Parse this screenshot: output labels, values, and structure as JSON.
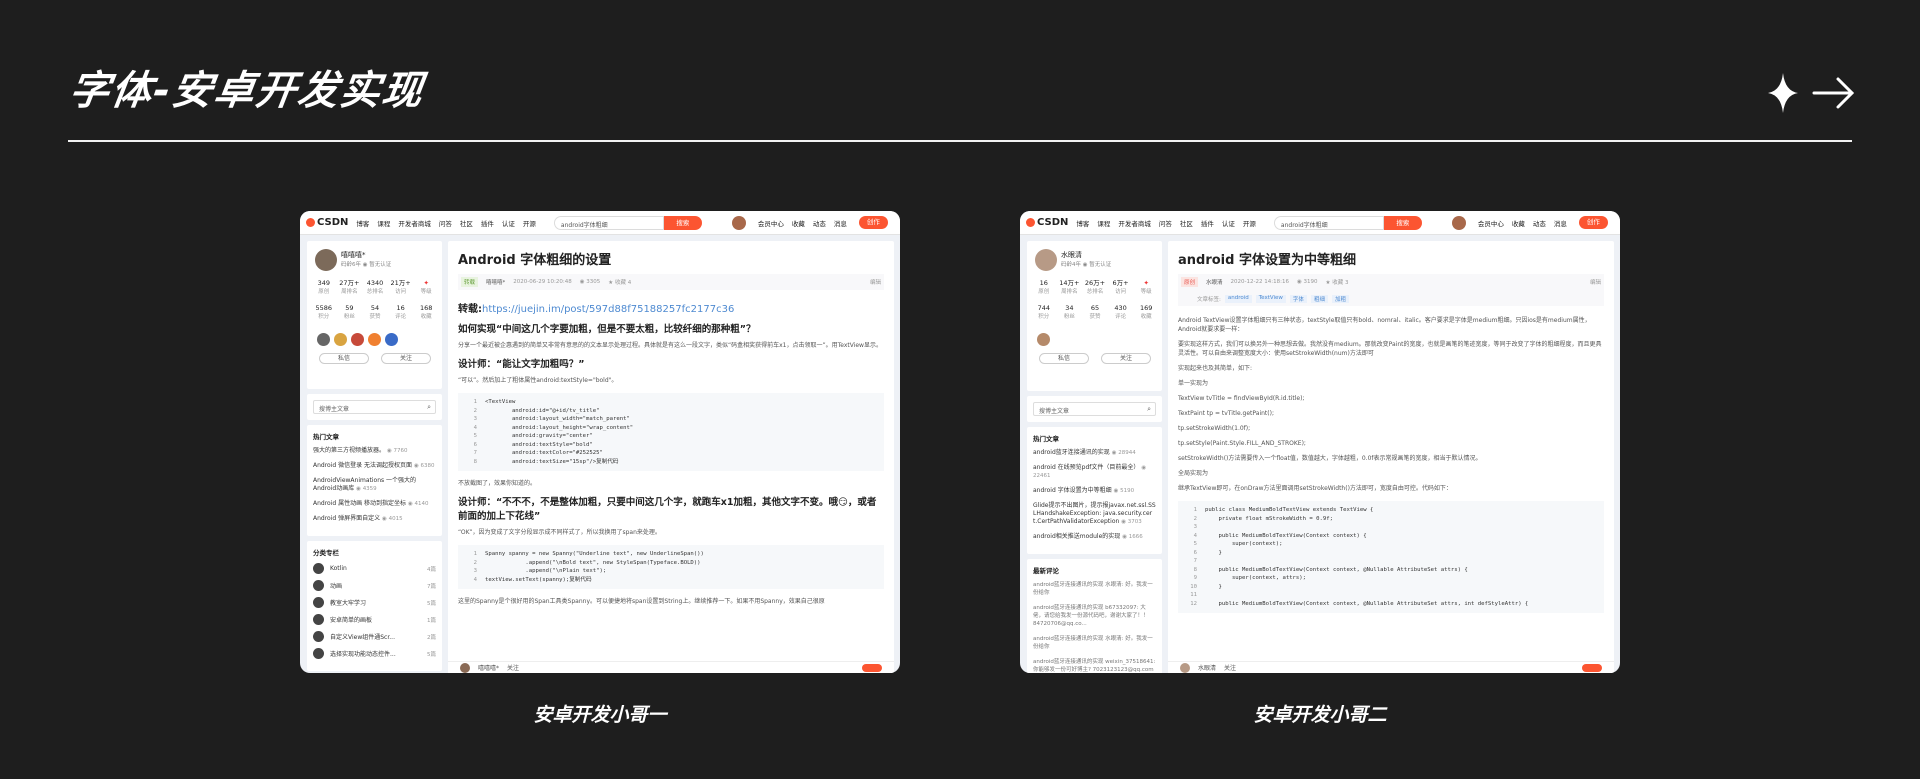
{
  "page": {
    "title": "字体-安卓开发实现",
    "colors": {
      "background": "#1e1e1e",
      "accent": "#fc5531",
      "rule": "#f2f2f2"
    },
    "icons": [
      "sparkle-icon",
      "arrow-right-icon"
    ]
  },
  "shared": {
    "nav_items": [
      "博客",
      "课程",
      "开发者商城",
      "问答",
      "社区",
      "插件",
      "认证",
      "开源"
    ],
    "search_btn": "搜索",
    "member": "会员中心",
    "nav_right": [
      "收藏",
      "动态",
      "消息"
    ],
    "create": "创作",
    "follow": "私信",
    "watch": "关注",
    "search_article": "搜博主文章",
    "hot_title": "热门文章",
    "cat_title": "分类专栏",
    "foot_follow": "关注"
  },
  "shot1": {
    "caption": "安卓开发小哥一",
    "search_value": "android字体粗细",
    "user": {
      "name": "嘻嘻嘻*",
      "meta": "码龄6年",
      "cert": "暂无认证"
    },
    "stats1": [
      {
        "v": "349",
        "l": "原创"
      },
      {
        "v": "27万+",
        "l": "周排名"
      },
      {
        "v": "4340",
        "l": "总排名"
      },
      {
        "v": "21万+",
        "l": "访问"
      },
      {
        "v": "",
        "l": "等级"
      }
    ],
    "stats2": [
      {
        "v": "5586",
        "l": "积分"
      },
      {
        "v": "59",
        "l": "粉丝"
      },
      {
        "v": "54",
        "l": "获赞"
      },
      {
        "v": "16",
        "l": "评论"
      },
      {
        "v": "168",
        "l": "收藏"
      }
    ],
    "hot": [
      {
        "t": "强大的第三方视频播放器。",
        "n": "7760"
      },
      {
        "t": "Android 微信登录 无法调起授权页面",
        "n": "6380"
      },
      {
        "t": "AndroidViewAnimations 一个强大的Android动画库",
        "n": "4359"
      },
      {
        "t": "Android 属性动画 移动到指定坐标",
        "n": "4140"
      },
      {
        "t": "Android 弹屏界面自定义",
        "n": "4015"
      }
    ],
    "cats": [
      {
        "t": "Kotlin",
        "n": "4篇"
      },
      {
        "t": "动画",
        "n": "7篇"
      },
      {
        "t": "教室大牢学习",
        "n": "5篇"
      },
      {
        "t": "安卓简单的画板",
        "n": "1篇"
      },
      {
        "t": "自定义View组件通Scr...",
        "n": "2篇"
      },
      {
        "t": "选择实现功能动态控件...",
        "n": "5篇"
      }
    ],
    "article": {
      "title": "Android 字体粗细的设置",
      "tag": "转载",
      "author": "嘻嘻嘻*",
      "date": "2020-06-29 10:20:48",
      "views": "3305",
      "fav": "收藏 4",
      "edit": "编辑",
      "repost_label": "转载:",
      "repost_link": "https://juejin.im/post/597d88f75188257fc2177c36",
      "h1": "如何实现“中间这几个字要加粗，但是不要太粗，比较纤细的那种粗”？",
      "p1": "分享一个最近被企惠遇到的简单又非常有意思的的文本显示处理过程。具体就是有这么一段文字，类似“码盒相奖获得前车x1，点击领取一”。用TextView显示。",
      "h2": "设计师：“能让文字加粗吗？”",
      "p2": "“可以”。然后加上了粗体属性android:textStyle=\"bold\"。",
      "code1": [
        "<TextView",
        "        android:id=\"@+id/tv_title\"",
        "        android:layout_width=\"match_parent\"",
        "        android:layout_height=\"wrap_content\"",
        "        android:gravity=\"center\"",
        "        android:textStyle=\"bold\"",
        "        android:textColor=\"#252525\"",
        "        android:textSize=\"15sp\"/>复制代码"
      ],
      "p3": "不放截图了，效果你知道的。",
      "h3": "设计师：“不不不，不是整体加粗，只要中间这几个字，就跑车x1加粗，其他文字不变。哦😏，或者前面的加上下花线”",
      "p4": "“OK”，因为变成了文字分段显示成不同样式了，所以我换用了span来处理。",
      "code2": [
        "Spanny spanny = new Spanny(\"Underline text\", new UnderlineSpan())",
        "            .append(\"\\nBold text\", new StyleSpan(Typeface.BOLD))",
        "            .append(\"\\nPlain text\");",
        "textView.setText(spanny);复制代码"
      ],
      "p5": "这里的Spanny是个很好用的Span工具类Spanny。可以便捷地将span设置到String上。继续推荐一下。如果不用Spanny，效果自己很原"
    }
  },
  "shot2": {
    "caption": "安卓开发小哥二",
    "search_value": "android字体粗细",
    "user": {
      "name": "水眼清",
      "meta": "码龄4年",
      "cert": "暂无认证"
    },
    "stats1": [
      {
        "v": "16",
        "l": "原创"
      },
      {
        "v": "14万+",
        "l": "周排名"
      },
      {
        "v": "26万+",
        "l": "总排名"
      },
      {
        "v": "6万+",
        "l": "访问"
      },
      {
        "v": "",
        "l": "等级"
      }
    ],
    "stats2": [
      {
        "v": "744",
        "l": "积分"
      },
      {
        "v": "34",
        "l": "粉丝"
      },
      {
        "v": "65",
        "l": "获赞"
      },
      {
        "v": "430",
        "l": "评论"
      },
      {
        "v": "169",
        "l": "收藏"
      }
    ],
    "hot": [
      {
        "t": "android蓝牙连接通讯的实现",
        "n": "28944"
      },
      {
        "t": "android 在线预览pdf文件（目前最全）",
        "n": "22461"
      },
      {
        "t": "android 字体设置为中等粗细",
        "n": "5190"
      },
      {
        "t": "Glide提示不出图片，提示报javax.net.ssl.SSLHandshakeException: java.security.cert.CertPathValidatorException",
        "n": "3703"
      },
      {
        "t": "android相关推送module的实现",
        "n": "1666"
      }
    ],
    "news_title": "最新评论",
    "news": [
      "android蓝牙连接通讯的实现 水眼清: 好。我发一份给你",
      "android蓝牙连接通讯的实现 b67332097: 大佬，请您给我发一份源代码吧，谢谢大家了！！84720706@qq.co...",
      "android蓝牙连接通讯的实现 水眼清: 好。我发一份给你",
      "android蓝牙连接通讯的实现 weixin_37518641: 你能够发一份可好博主? 7023123123@qq.com"
    ],
    "article": {
      "title": "android 字体设置为中等粗细",
      "tag": "原创",
      "author": "水眼清",
      "date": "2020-12-22 14:18:16",
      "views": "3190",
      "fav": "收藏 3",
      "edit": "编辑",
      "labels": [
        "文章标签:",
        "android",
        "TextView",
        "字体",
        "粗细",
        "加粗"
      ],
      "p1": "Android TextView设置字体粗细只有三种状态，textStyle取值只有bold、nomral、italic。客户要求是字体是medium粗细。只因ios是有medium属性，Android就要求要一样：",
      "p2": "要实现这样方式，我们可以换另外一种思想去做。我然没有medium。那就改变Paint的宽度，也就是画笔的笔迹宽度，等同于改变了字体的粗细程度，而且更具灵活性。可以自由来调整宽度大小：使用setStrokeWidth(num)方法即可",
      "p3": "实现起来也及其简单，如下:",
      "p4": "单一实现为",
      "p5": "TextView tvTitle = findViewById(R.id.title);",
      "p6": "TextPaint  tp = tvTitle.getPaint();",
      "p7": "tp.setStrokeWidth(1.0f);",
      "p8": "tp.setStyle(Paint.Style.FILL_AND_STROKE);",
      "p9": "setStrokeWidth()方法需要传入一个float值，数值越大，字体越粗，0.0f表示常规画笔的宽度，相当于默认情况。",
      "p10": "全局实现为",
      "p11": "继承TextView即可，在onDraw方法里面调用setStrokeWidth()方法即可，宽度自由可控。代码如下：",
      "code": [
        "public class MediumBoldTextView extends TextView {",
        "    private float mStrokeWidth = 0.9f;",
        "",
        "    public MediumBoldTextView(Context context) {",
        "        super(context);",
        "    }",
        "",
        "    public MediumBoldTextView(Context context, @Nullable AttributeSet attrs) {",
        "        super(context, attrs);",
        "    }",
        "",
        "    public MediumBoldTextView(Context context, @Nullable AttributeSet attrs, int defStyleAttr) {"
      ]
    }
  }
}
